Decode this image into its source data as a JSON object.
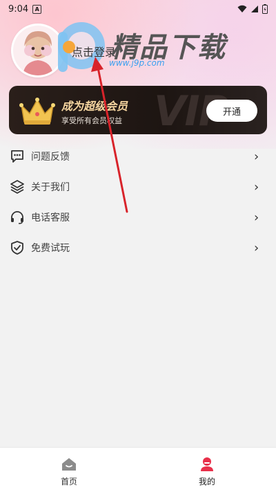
{
  "status_bar": {
    "time": "9:04",
    "app_badge": "A"
  },
  "profile": {
    "login_label": "点击登录"
  },
  "watermark": {
    "name": "精品下载",
    "url": "www.j9p.com"
  },
  "vip": {
    "bg_text": "VIP",
    "title": "成为超级会员",
    "subtitle": "享受所有会员权益",
    "button": "开通"
  },
  "menu": [
    {
      "label": "问题反馈",
      "icon": "feedback-icon"
    },
    {
      "label": "关于我们",
      "icon": "layers-icon"
    },
    {
      "label": "电话客服",
      "icon": "headset-icon"
    },
    {
      "label": "免费试玩",
      "icon": "shield-check-icon"
    }
  ],
  "bottom_nav": [
    {
      "label": "首页",
      "icon": "home-icon",
      "active": false
    },
    {
      "label": "我的",
      "icon": "profile-icon",
      "active": true
    }
  ],
  "colors": {
    "active": "#e8304a",
    "inactive": "#333333",
    "vip_gold": "#f6d6a0"
  }
}
